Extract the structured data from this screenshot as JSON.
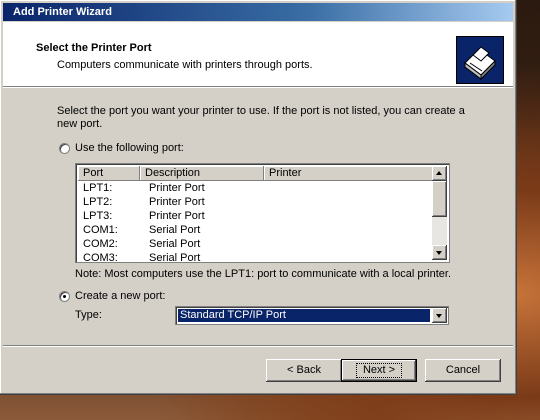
{
  "window": {
    "title": "Add Printer Wizard"
  },
  "header": {
    "title": "Select the Printer Port",
    "subtitle": "Computers communicate with printers through ports."
  },
  "intro": {
    "line1": "Select the port you want your printer to use.  If the port is not listed, you can create a",
    "line2": "new port."
  },
  "use_port": {
    "label": "Use the following port:",
    "checked": false
  },
  "port_list": {
    "columns": [
      "Port",
      "Description",
      "Printer"
    ],
    "rows": [
      {
        "port": "LPT1:",
        "description": "Printer Port"
      },
      {
        "port": "LPT2:",
        "description": "Printer Port"
      },
      {
        "port": "LPT3:",
        "description": "Printer Port"
      },
      {
        "port": "COM1:",
        "description": "Serial Port"
      },
      {
        "port": "COM2:",
        "description": "Serial Port"
      },
      {
        "port": "COM3:",
        "description": "Serial Port"
      }
    ]
  },
  "note": "Note: Most computers use the LPT1: port to communicate with a local printer.",
  "create_port": {
    "label": "Create a new port:",
    "checked": true,
    "type_label": "Type:",
    "type_value": "Standard TCP/IP Port"
  },
  "buttons": {
    "back": "< Back",
    "next": "Next >",
    "cancel": "Cancel"
  },
  "colors": {
    "titlebar": "#0a246a",
    "dialog": "#d4d0c8",
    "selection": "#0a246a"
  }
}
